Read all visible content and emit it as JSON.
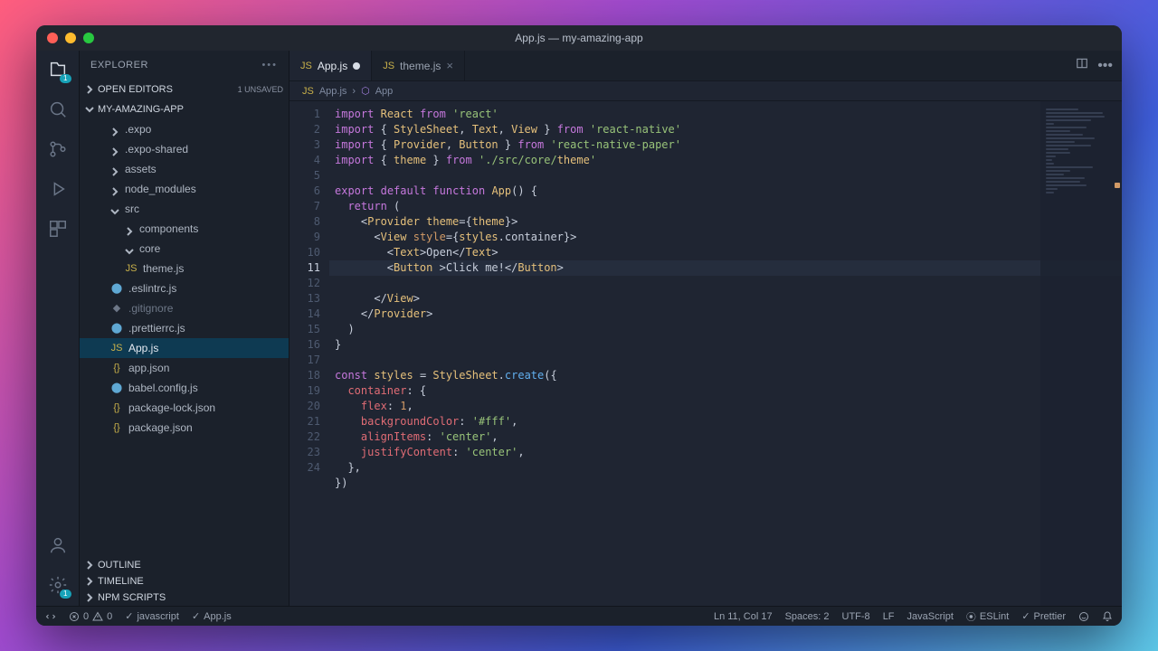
{
  "window": {
    "title": "App.js — my-amazing-app"
  },
  "activitybar": {
    "explorer_badge": "1",
    "settings_badge": "1"
  },
  "sidebar": {
    "title": "EXPLORER",
    "sections": {
      "openEditors": {
        "label": "OPEN EDITORS",
        "tag": "1 UNSAVED"
      },
      "project": {
        "label": "MY-AMAZING-APP"
      },
      "outline": {
        "label": "OUTLINE"
      },
      "timeline": {
        "label": "TIMELINE"
      },
      "npm": {
        "label": "NPM SCRIPTS"
      }
    },
    "tree": [
      {
        "label": ".expo",
        "kind": "folder",
        "depth": 2
      },
      {
        "label": ".expo-shared",
        "kind": "folder",
        "depth": 2
      },
      {
        "label": "assets",
        "kind": "folder",
        "depth": 2
      },
      {
        "label": "node_modules",
        "kind": "folder",
        "depth": 2
      },
      {
        "label": "src",
        "kind": "folder-open",
        "depth": 2
      },
      {
        "label": "components",
        "kind": "folder",
        "depth": 3
      },
      {
        "label": "core",
        "kind": "folder-open",
        "depth": 3
      },
      {
        "label": "theme.js",
        "kind": "js",
        "depth": 3,
        "icon": "JS"
      },
      {
        "label": ".eslintrc.js",
        "kind": "conf",
        "depth": 2,
        "icon": "⬤"
      },
      {
        "label": ".gitignore",
        "kind": "dim",
        "depth": 2,
        "icon": "◆"
      },
      {
        "label": ".prettierrc.js",
        "kind": "conf",
        "depth": 2,
        "icon": "⬤"
      },
      {
        "label": "App.js",
        "kind": "js",
        "depth": 2,
        "icon": "JS",
        "selected": true
      },
      {
        "label": "app.json",
        "kind": "json",
        "depth": 2,
        "icon": "{}"
      },
      {
        "label": "babel.config.js",
        "kind": "conf",
        "depth": 2,
        "icon": "⬤"
      },
      {
        "label": "package-lock.json",
        "kind": "json",
        "depth": 2,
        "icon": "{}"
      },
      {
        "label": "package.json",
        "kind": "json",
        "depth": 2,
        "icon": "{}"
      }
    ]
  },
  "tabs": [
    {
      "label": "App.js",
      "modified": true,
      "active": true
    },
    {
      "label": "theme.js",
      "modified": false,
      "active": false
    }
  ],
  "breadcrumb": {
    "file": "App.js",
    "symbol": "App"
  },
  "editor": {
    "highlight_line": 11,
    "line_count": 24
  },
  "statusbar": {
    "errors": "0",
    "warnings": "0",
    "lang_mode": "javascript",
    "file": "App.js",
    "position": "Ln 11, Col 17",
    "spaces": "Spaces: 2",
    "encoding": "UTF-8",
    "eol": "LF",
    "language": "JavaScript",
    "eslint": "ESLint",
    "prettier": "Prettier"
  },
  "code_lines": [
    "import React from 'react'",
    "import { StyleSheet, Text, View } from 'react-native'",
    "import { Provider, Button } from 'react-native-paper'",
    "import { theme } from './src/core/theme'",
    "",
    "export default function App() {",
    "  return (",
    "    <Provider theme={theme}>",
    "      <View style={styles.container}>",
    "        <Text>Open</Text>",
    "        <Button >Click me!</Button>",
    "      </View>",
    "    </Provider>",
    "  )",
    "}",
    "",
    "const styles = StyleSheet.create({",
    "  container: {",
    "    flex: 1,",
    "    backgroundColor: '#fff',",
    "    alignItems: 'center',",
    "    justifyContent: 'center',",
    "  },",
    "})"
  ]
}
